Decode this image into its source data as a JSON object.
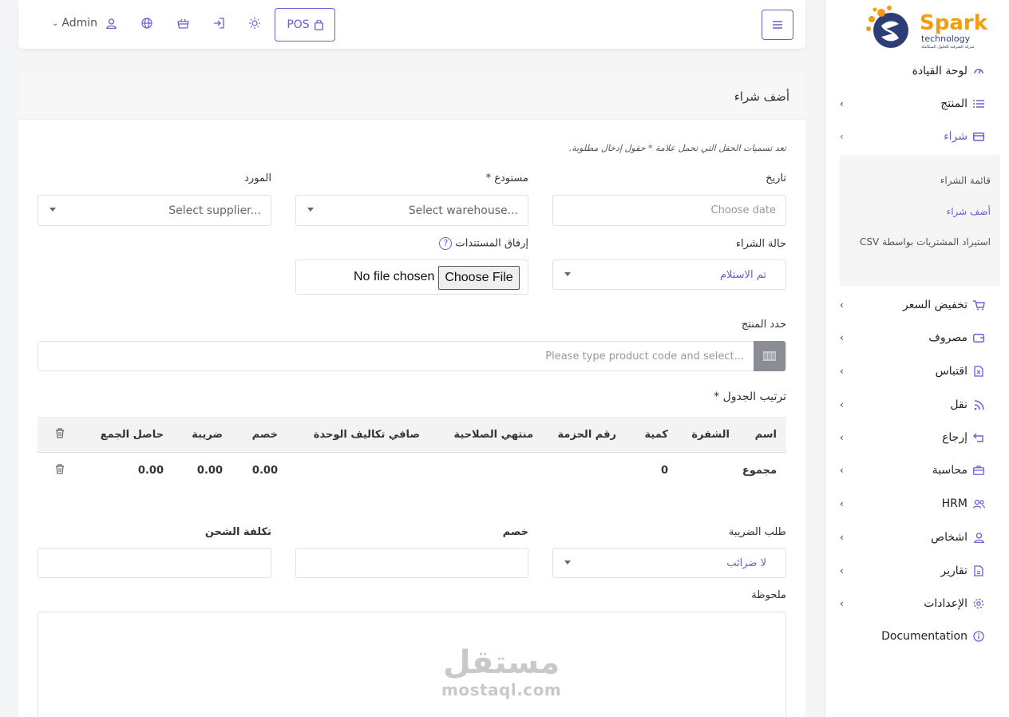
{
  "brand": {
    "name": "Spark",
    "sub": "technology",
    "tagline": "شركة الشرقية للحلول المتكاملة"
  },
  "sidebar": {
    "items": [
      {
        "label": "لوحة القيادة",
        "icon": "gauge-icon"
      },
      {
        "label": "المنتج",
        "icon": "list-icon"
      },
      {
        "label": "شراء",
        "icon": "card-icon"
      },
      {
        "label": "تخفيض السعر",
        "icon": "cart-icon"
      },
      {
        "label": "مصروف",
        "icon": "wallet-icon"
      },
      {
        "label": "اقتباس",
        "icon": "file-x-icon"
      },
      {
        "label": "نقل",
        "icon": "rss-icon"
      },
      {
        "label": "إرجاع",
        "icon": "return-icon"
      },
      {
        "label": "محاسبة",
        "icon": "briefcase-icon"
      },
      {
        "label": "HRM",
        "icon": "users-icon"
      },
      {
        "label": "اشخاص",
        "icon": "user-icon"
      },
      {
        "label": "تقارير",
        "icon": "report-icon"
      },
      {
        "label": "الإعدادات",
        "icon": "gear-icon"
      },
      {
        "label": "Documentation",
        "icon": "info-icon"
      }
    ],
    "submenu": [
      {
        "label": "قائمة الشراء"
      },
      {
        "label": "أضف شراء"
      },
      {
        "label": "استيراد المشتريات بواسطة CSV"
      }
    ]
  },
  "topbar": {
    "pos_label": "POS",
    "user_label": "Admin"
  },
  "page": {
    "title": "أضف شراء",
    "required_note": "تعد تسميات الحقل التي تحمل علامة * حقول إدخال مطلوبة.",
    "date_label": "تاريخ",
    "date_placeholder": "Choose date",
    "warehouse_label": "مستودع *",
    "warehouse_placeholder": "Select warehouse...",
    "supplier_label": "المورد",
    "supplier_placeholder": "Select supplier...",
    "status_label": "حالة الشراء",
    "status_value": "تم الاستلام",
    "attach_label": "إرفاق المستندات",
    "file_button": "Choose File",
    "file_status": "No file chosen",
    "product_label": "حدد المنتج",
    "product_placeholder": "Please type product code and select...",
    "order_label": "ترتيب الجدول *",
    "tax_label": "طلب الضريبة",
    "tax_value": "لا ضرائب",
    "discount_label": "خصم",
    "shipping_label": "تكلفة الشحن",
    "note_label": "ملحوظة"
  },
  "table": {
    "headers": [
      "اسم",
      "الشفرة",
      "كمية",
      "رقم الحزمة",
      "منتهي الصلاحية",
      "صافي تكاليف الوحدة",
      "خصم",
      "ضريبة",
      "حاصل الجمع"
    ],
    "footer": {
      "label": "مجموع",
      "qty": "0",
      "discount": "0.00",
      "tax": "0.00",
      "total": "0.00"
    }
  },
  "watermark": {
    "ar": "مستقل",
    "en": "mostaql.com"
  },
  "colors": {
    "accent": "#6c5dd3",
    "brand_orange": "#f39c12"
  }
}
